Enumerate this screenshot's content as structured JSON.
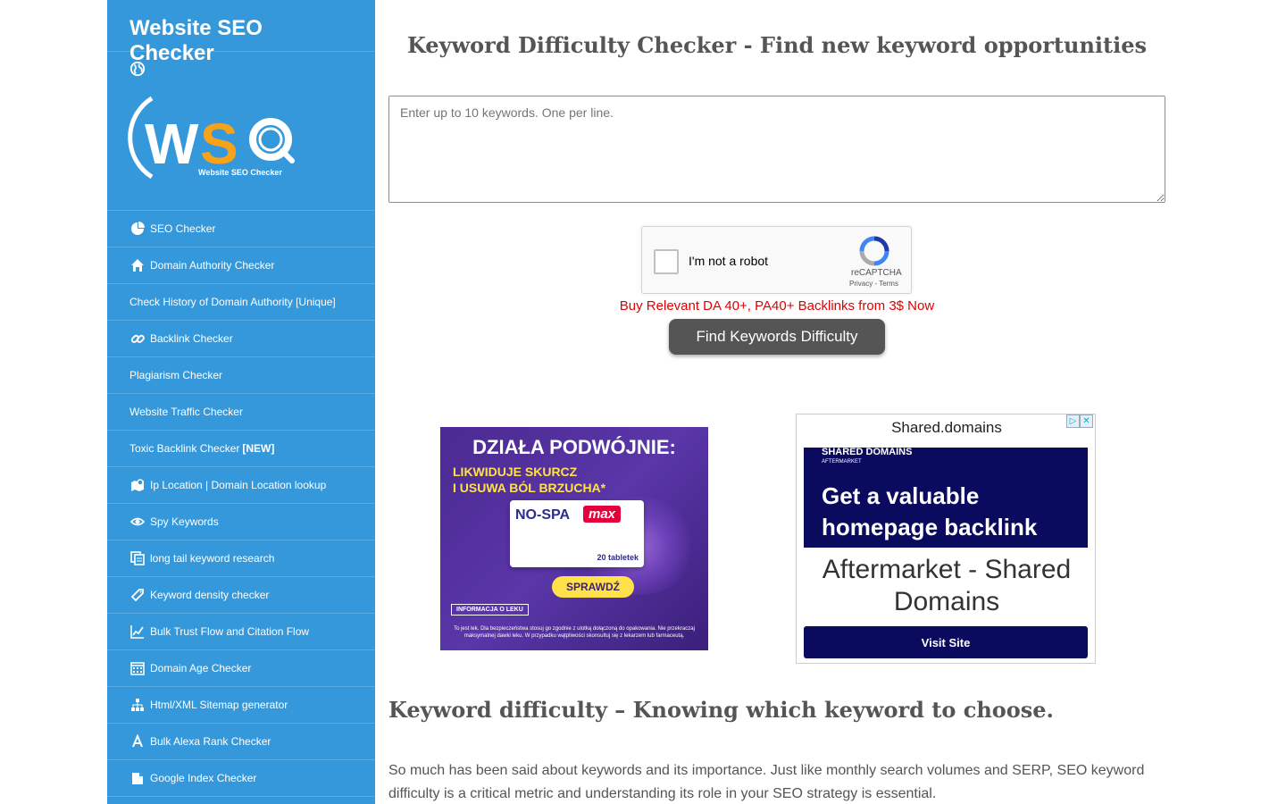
{
  "sidebar": {
    "brand": "Website SEO Checker",
    "logo_text": "WSC",
    "logo_caption": "Website SEO Checker",
    "items": [
      {
        "label": "SEO Checker",
        "icon": "pie-chart-icon",
        "new": ""
      },
      {
        "label": "Domain Authority Checker",
        "icon": "home-icon",
        "new": ""
      },
      {
        "label": "Check History of Domain Authority [Unique]",
        "icon": "",
        "new": ""
      },
      {
        "label": "Backlink Checker",
        "icon": "link-icon",
        "new": ""
      },
      {
        "label": "Plagiarism Checker",
        "icon": "",
        "new": ""
      },
      {
        "label": "Website Traffic Checker",
        "icon": "",
        "new": ""
      },
      {
        "label": "Toxic Backlink Checker",
        "icon": "",
        "new": "[NEW]"
      },
      {
        "label": "Ip Location | Domain Location lookup",
        "icon": "map-icon",
        "new": ""
      },
      {
        "label": "Spy Keywords",
        "icon": "eye-icon",
        "new": ""
      },
      {
        "label": "long tail keyword research",
        "icon": "copy-docs-icon",
        "new": ""
      },
      {
        "label": "Keyword density checker",
        "icon": "tag-icon",
        "new": ""
      },
      {
        "label": "Bulk Trust Flow and Citation Flow",
        "icon": "line-chart-icon",
        "new": ""
      },
      {
        "label": "Domain Age Checker",
        "icon": "calendar-icon",
        "new": ""
      },
      {
        "label": "Html/XML Sitemap generator",
        "icon": "sitemap-icon",
        "new": ""
      },
      {
        "label": "Bulk Alexa Rank Checker",
        "icon": "letter-a-icon",
        "new": ""
      },
      {
        "label": "Google Index Checker",
        "icon": "document-icon",
        "new": ""
      }
    ]
  },
  "main": {
    "title": "Keyword Difficulty Checker - Find new keyword opportunities",
    "input_placeholder": "Enter up to 10 keywords. One per line.",
    "captcha": {
      "label": "I'm not a robot",
      "brand": "reCAPTCHA",
      "terms": "Privacy - Terms"
    },
    "promo_link": "Buy Relevant DA 40+, PA40+ Backlinks from 3$ Now",
    "button_label": "Find Keywords Difficulty",
    "section_title": "Keyword difficulty – Knowing which keyword to choose.",
    "paragraph": "So much has been said about keywords and its importance. Just like monthly search volumes and SERP, SEO keyword difficulty is a critical metric and understanding its role in your SEO strategy is essential."
  },
  "ad1": {
    "headline": "DZIAŁA PODWÓJNIE:",
    "sub1": "LIKWIDUJE SKURCZ",
    "sub2": "I USUWA BÓL BRZUCHA*",
    "product": "NO-SPA",
    "product_max": "max",
    "pack_count": "20 tabletek",
    "cta": "SPRAWDŹ",
    "info": "INFORMACJA O LEKU",
    "fine_print": "To jest lek. Dla bezpieczeństwa stosuj go zgodnie z ulotką dołączoną do opakowania. Nie przekraczaj maksymalnej dawki leku. W przypadku wątpliwości skonsultuj się z lekarzem lub farmaceutą."
  },
  "ad2": {
    "domain": "Shared.domains",
    "banner_brand": "SHARED DOMAINS",
    "banner_brand_sub": "AFTERMARKET",
    "banner_line1": "Get a valuable",
    "banner_line2": "homepage backlink",
    "aftermarket": "Aftermarket - Shared Domains",
    "cta": "Visit Site"
  },
  "colors": {
    "sidebar": "#3498db",
    "button": "#555555",
    "promo": "#e00000",
    "ad_navy": "#0a0a5e"
  }
}
